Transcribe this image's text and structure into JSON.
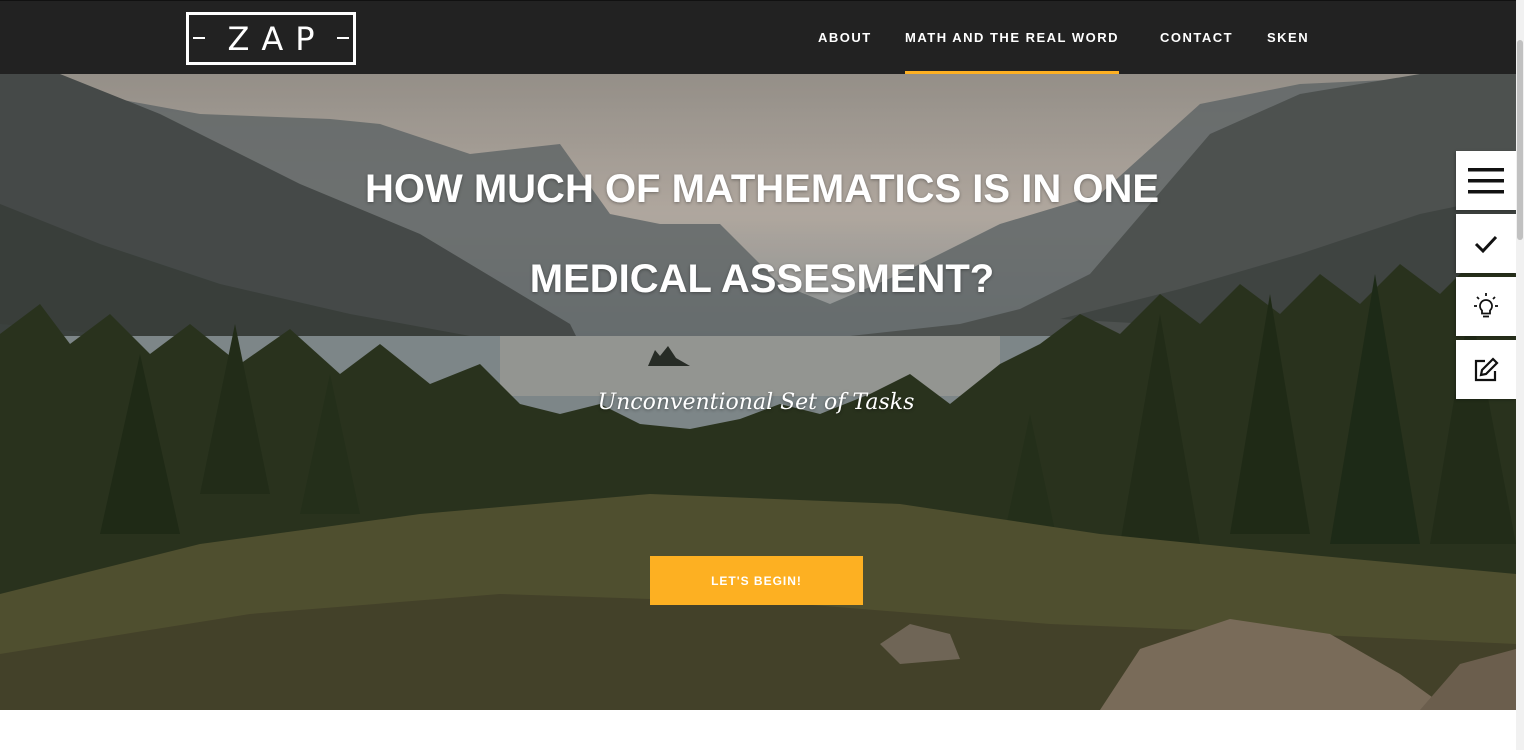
{
  "logo": {
    "text": "ZAP"
  },
  "nav": {
    "items": [
      {
        "label": "ABOUT",
        "active": false
      },
      {
        "label": "MATH AND THE REAL WORD",
        "active": true
      },
      {
        "label": "CONTACT",
        "active": false
      },
      {
        "label": "SKEN",
        "active": false
      }
    ]
  },
  "hero": {
    "title_line1": "HOW MUCH OF MATHEMATICS IS IN ONE",
    "title_line2": "MEDICAL ASSESMENT?",
    "subtitle": "Unconventional Set of Tasks",
    "cta_label": "LET'S BEGIN!"
  },
  "side_tools": [
    {
      "icon": "menu-icon"
    },
    {
      "icon": "check-icon"
    },
    {
      "icon": "lightbulb-icon"
    },
    {
      "icon": "edit-icon"
    }
  ],
  "colors": {
    "accent": "#fdb022",
    "navbar": "#222222",
    "text_light": "#ffffff"
  }
}
